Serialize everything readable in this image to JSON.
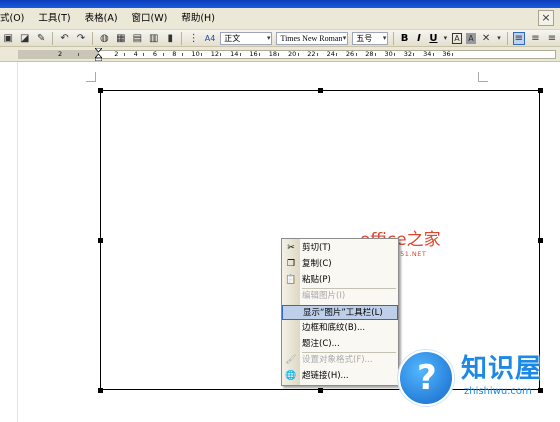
{
  "menubar": {
    "items": [
      "式(O)",
      "工具(T)",
      "表格(A)",
      "窗口(W)",
      "帮助(H)"
    ],
    "close_glyph": "×"
  },
  "toolbar": {
    "style_value": "正文",
    "font_value": "Times New Roman",
    "size_value": "五号",
    "bold": "B",
    "italic": "I",
    "underline": "U",
    "style_icon_text": "A4"
  },
  "ruler": {
    "numbers": [
      "2",
      "2",
      "4",
      "6",
      "8",
      "10",
      "12",
      "14",
      "16",
      "18",
      "20",
      "22",
      "24",
      "26",
      "28",
      "30",
      "32",
      "34",
      "36"
    ]
  },
  "watermark": {
    "main": "office之家",
    "sub": "OFFICE.JB51.NET"
  },
  "context_menu": {
    "items": [
      {
        "label": "剪切(T)",
        "icon": "scissors-icon",
        "glyph": "✂",
        "disabled": false,
        "highlight": false
      },
      {
        "label": "复制(C)",
        "icon": "copy-icon",
        "glyph": "❐",
        "disabled": false,
        "highlight": false
      },
      {
        "label": "粘贴(P)",
        "icon": "paste-icon",
        "glyph": "📋",
        "disabled": false,
        "highlight": false
      },
      {
        "label": "编辑图片(I)",
        "icon": "",
        "glyph": "",
        "disabled": true,
        "highlight": false
      },
      {
        "label": "显示“图片”工具栏(L)",
        "icon": "",
        "glyph": "",
        "disabled": false,
        "highlight": true
      },
      {
        "label": "边框和底纹(B)...",
        "icon": "",
        "glyph": "",
        "disabled": false,
        "highlight": false
      },
      {
        "label": "题注(C)...",
        "icon": "",
        "glyph": "",
        "disabled": false,
        "highlight": false
      },
      {
        "label": "设置对象格式(F)...",
        "icon": "format-object-icon",
        "glyph": "🖌",
        "disabled": true,
        "highlight": false
      },
      {
        "label": "超链接(H)...",
        "icon": "hyperlink-icon",
        "glyph": "🌐",
        "disabled": false,
        "highlight": false
      }
    ]
  },
  "logo": {
    "glyph": "?",
    "main": "知识屋",
    "domain": "zhishiwu.com"
  },
  "colors": {
    "watermark": "#e1452b",
    "menu_highlight": "#bdcfe9",
    "logo_blue": "#1e88e5"
  }
}
